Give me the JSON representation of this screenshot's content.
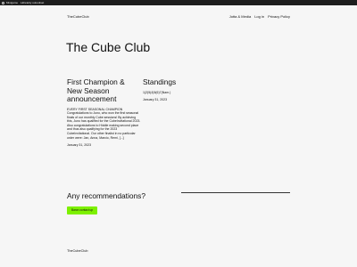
{
  "admin_bar": {
    "items": [
      "Minigame",
      "Lähetetty uutuutiset"
    ]
  },
  "header": {
    "site_title": "TheCubeClub",
    "nav": [
      "Jotta & Media",
      "Log in",
      "Privacy Policy"
    ]
  },
  "main": {
    "heading": "The Cube Club",
    "posts": [
      {
        "title": "First Champion & New Season announcement",
        "excerpt": "EVERY FIRST SEASONAL CHAMPION Congratulations to Juno, who won the first seasonal finals of our monthly Cube sessions! By achieving this, Juno has qualified for the CubeInvitational 2023. Also congratulations to Hiddle making second place and thus also qualifying for the 2023 CubeInvitational. Our other finalist in no particular order were: Jan, Anna, Marcio, Remi, [...]",
        "date": "January 31, 2023"
      },
      {
        "title": "Standings",
        "excerpt": "1(2)5(4)5(6)7(Nam.)",
        "date": "January 31, 2023"
      }
    ]
  },
  "recommendations": {
    "heading": "Any recommendations?",
    "button_label": "Baron contact up"
  },
  "footer": {
    "site_title": "TheCubeClub"
  }
}
